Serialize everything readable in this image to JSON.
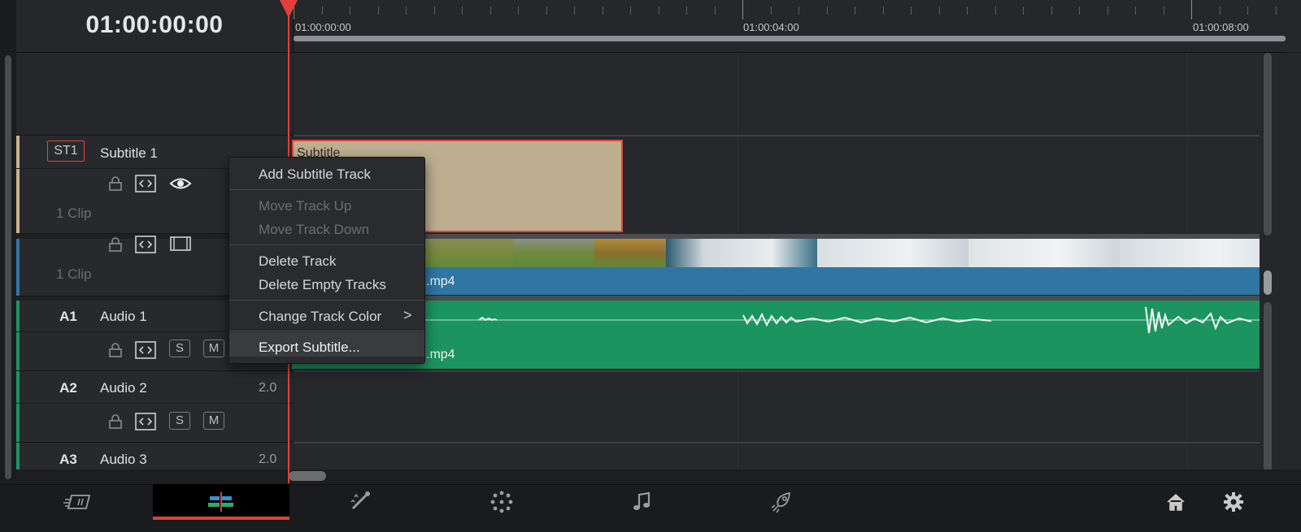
{
  "header": {
    "timecode": "01:00:00:00"
  },
  "ruler": {
    "labels": [
      "01:00:00:00",
      "01:00:04:00",
      "01:00:08:00"
    ]
  },
  "tracks": {
    "subtitle": {
      "id": "ST1",
      "name": "Subtitle 1",
      "clips": "1 Clip",
      "color": "#c8b48e"
    },
    "video": {
      "clips": "1 Clip",
      "color": "#2f76a4"
    },
    "audio1": {
      "id": "A1",
      "name": "Audio 1",
      "color": "#1c9460"
    },
    "audio2": {
      "id": "A2",
      "name": "Audio 2",
      "channels": "2.0",
      "color": "#1c9460"
    },
    "audio3": {
      "id": "A3",
      "name": "Audio 3",
      "channels": "2.0",
      "color": "#1c9460"
    }
  },
  "buttons": {
    "solo": "S",
    "mute": "M"
  },
  "clips": {
    "subtitle": {
      "label": "Subtitle"
    },
    "video": {
      "label": ".mp4"
    },
    "audio": {
      "label": ".mp4"
    }
  },
  "context_menu": {
    "items": [
      {
        "label": "Add Subtitle Track",
        "enabled": true
      },
      {
        "label": "Move Track Up",
        "enabled": false
      },
      {
        "label": "Move Track Down",
        "enabled": false
      },
      {
        "label": "Delete Track",
        "enabled": true
      },
      {
        "label": "Delete Empty Tracks",
        "enabled": true
      },
      {
        "label": "Change Track Color",
        "enabled": true,
        "submenu_glyph": ">"
      },
      {
        "label": "Export Subtitle...",
        "enabled": true
      }
    ]
  },
  "bottom_nav": {
    "icons": [
      "cut-page-icon",
      "edit-page-icon",
      "fusion-page-icon",
      "color-page-icon",
      "fairlight-page-icon",
      "deliver-page-icon",
      "home-icon",
      "settings-icon"
    ],
    "active": "edit-page-icon",
    "accent": "#e0403a"
  }
}
